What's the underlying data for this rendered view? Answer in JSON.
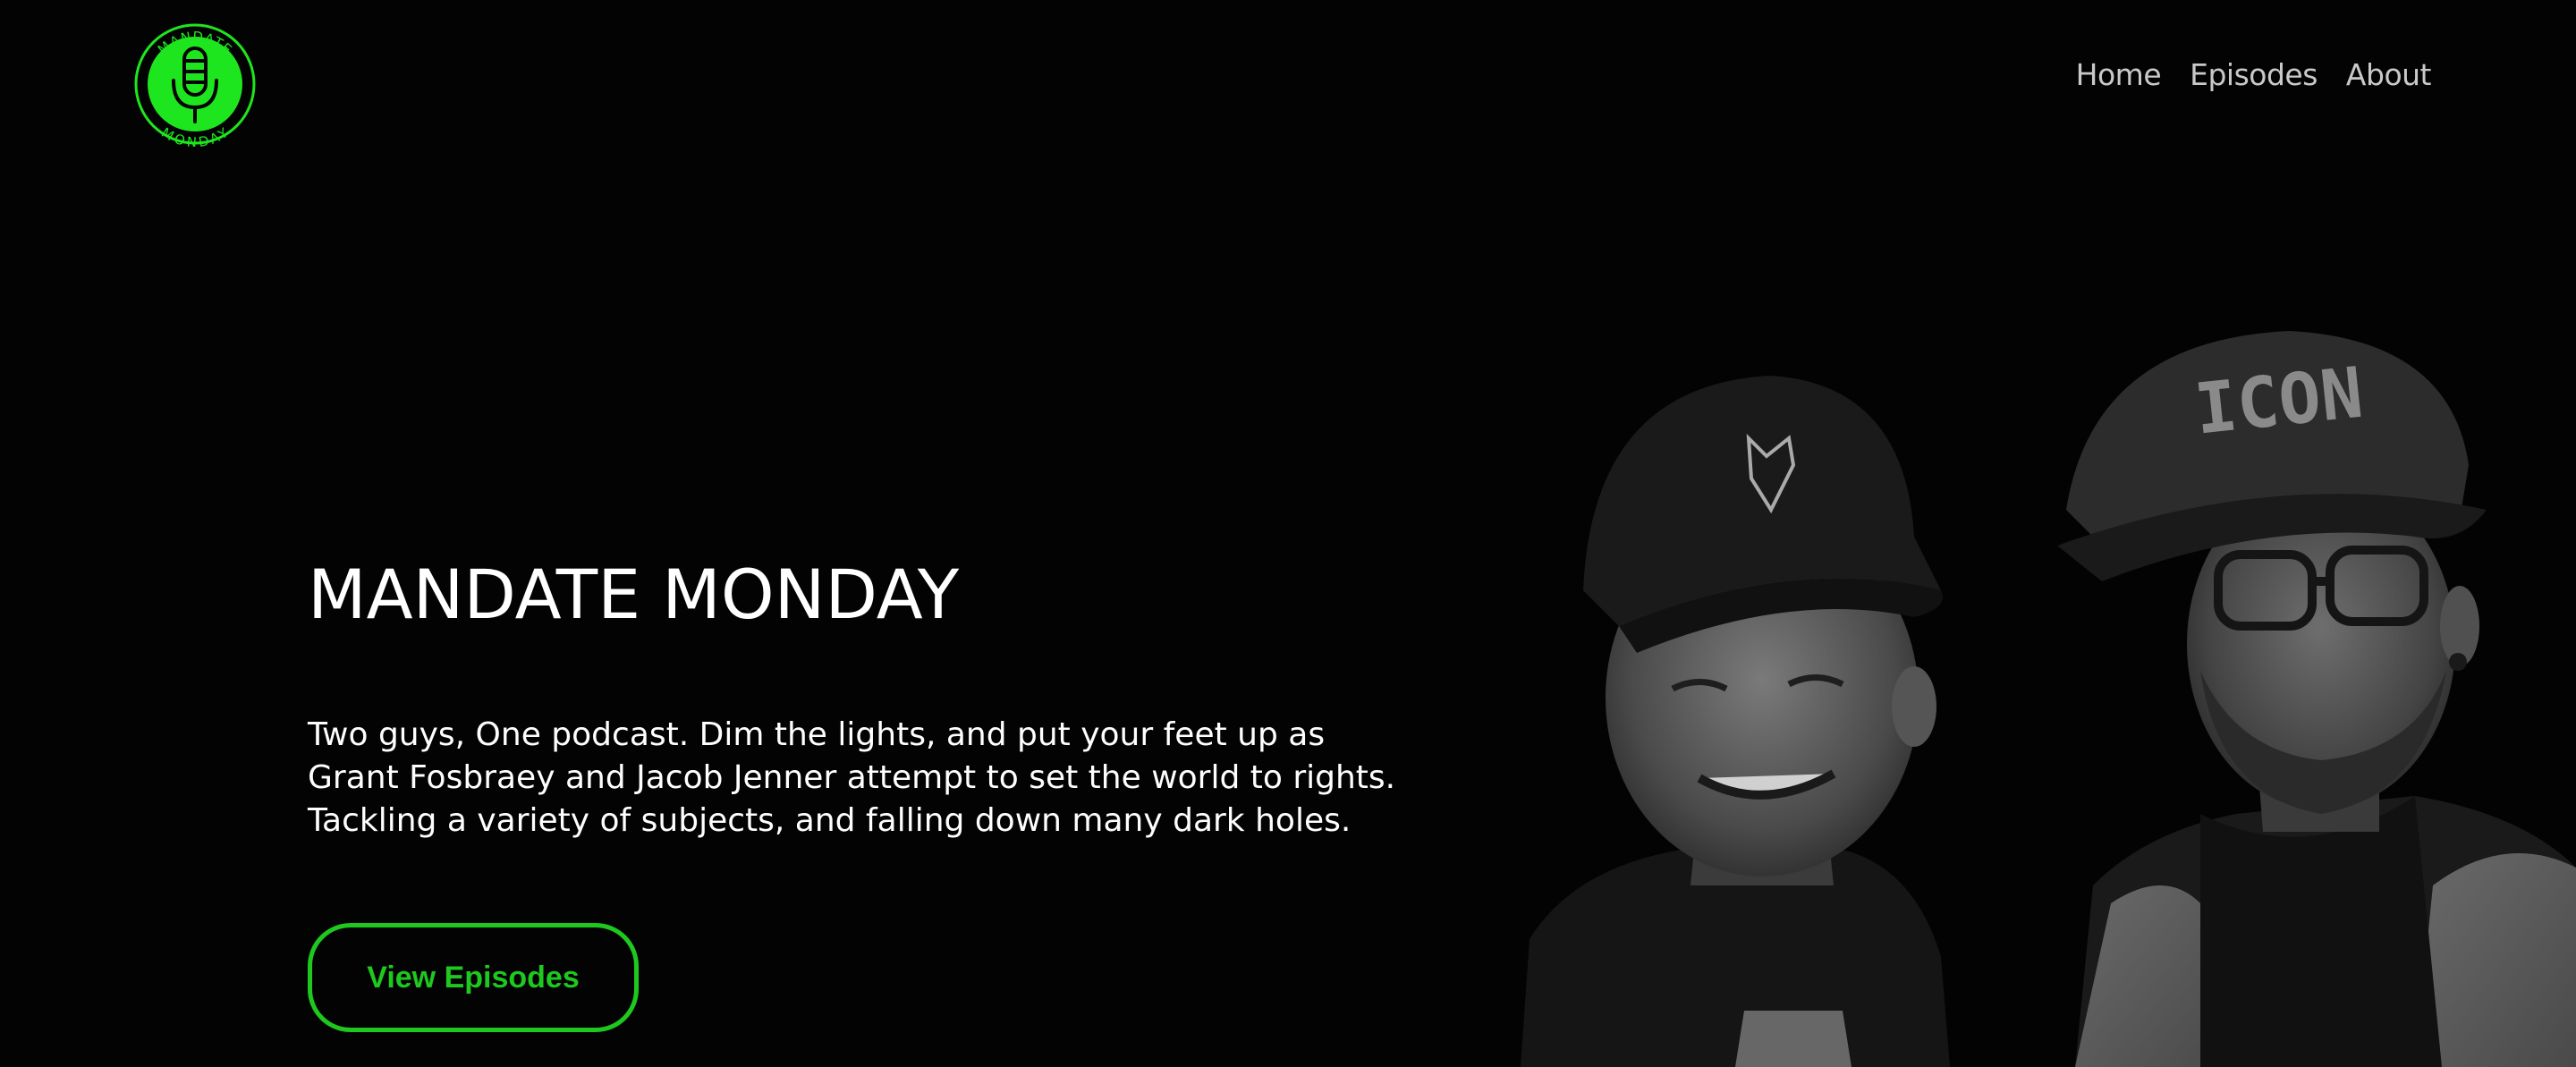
{
  "brand": {
    "logo_text_top": "MANDATE",
    "logo_text_bottom": "MONDAY",
    "accent_color": "#1ec81e",
    "logo_color": "#1ee61e"
  },
  "nav": {
    "items": [
      {
        "label": "Home"
      },
      {
        "label": "Episodes"
      },
      {
        "label": "About"
      }
    ]
  },
  "hero": {
    "title": "MANDATE MONDAY",
    "description_lines": [
      "Two guys, One podcast. Dim the lights, and put your feet up as",
      "Grant Fosbraey and Jacob Jenner attempt to set the world to rights.",
      "Tackling a variety of subjects, and falling down many dark holes."
    ],
    "cta_label": "View Episodes",
    "photo_cap_text": "ICON"
  },
  "icons": {
    "logo": "microphone-logo-icon"
  }
}
